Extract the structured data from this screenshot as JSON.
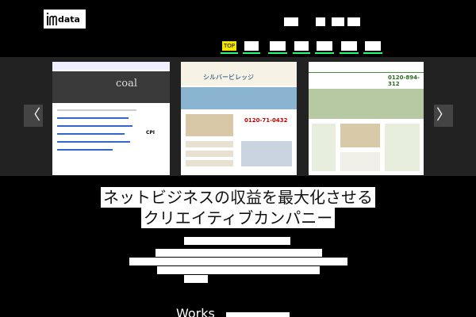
{
  "header": {
    "logo_text": "data",
    "gnav": [
      {
        "label": "TOP",
        "active": true
      },
      {
        "label": "",
        "active": false
      },
      {
        "label": "",
        "active": false
      },
      {
        "label": "",
        "active": false
      },
      {
        "label": "",
        "active": false
      },
      {
        "label": "",
        "active": false
      },
      {
        "label": "",
        "active": false
      }
    ]
  },
  "slider": {
    "prev_glyph": "〈",
    "next_glyph": "〉",
    "slides": [
      {
        "hero_word": "coal",
        "brand": "CPI"
      },
      {
        "title": "シルバービレッジ",
        "phone": "0120-71-0432"
      },
      {
        "phone": "0120-894-312"
      }
    ]
  },
  "tagline": {
    "line1": "ネットビジネスの収益を最大化させる",
    "line2": "クリエイティブカンパニー"
  },
  "works": {
    "title": "Works"
  },
  "colors": {
    "accent_yellow": "#f5e400",
    "accent_green": "#2f7f3f"
  }
}
